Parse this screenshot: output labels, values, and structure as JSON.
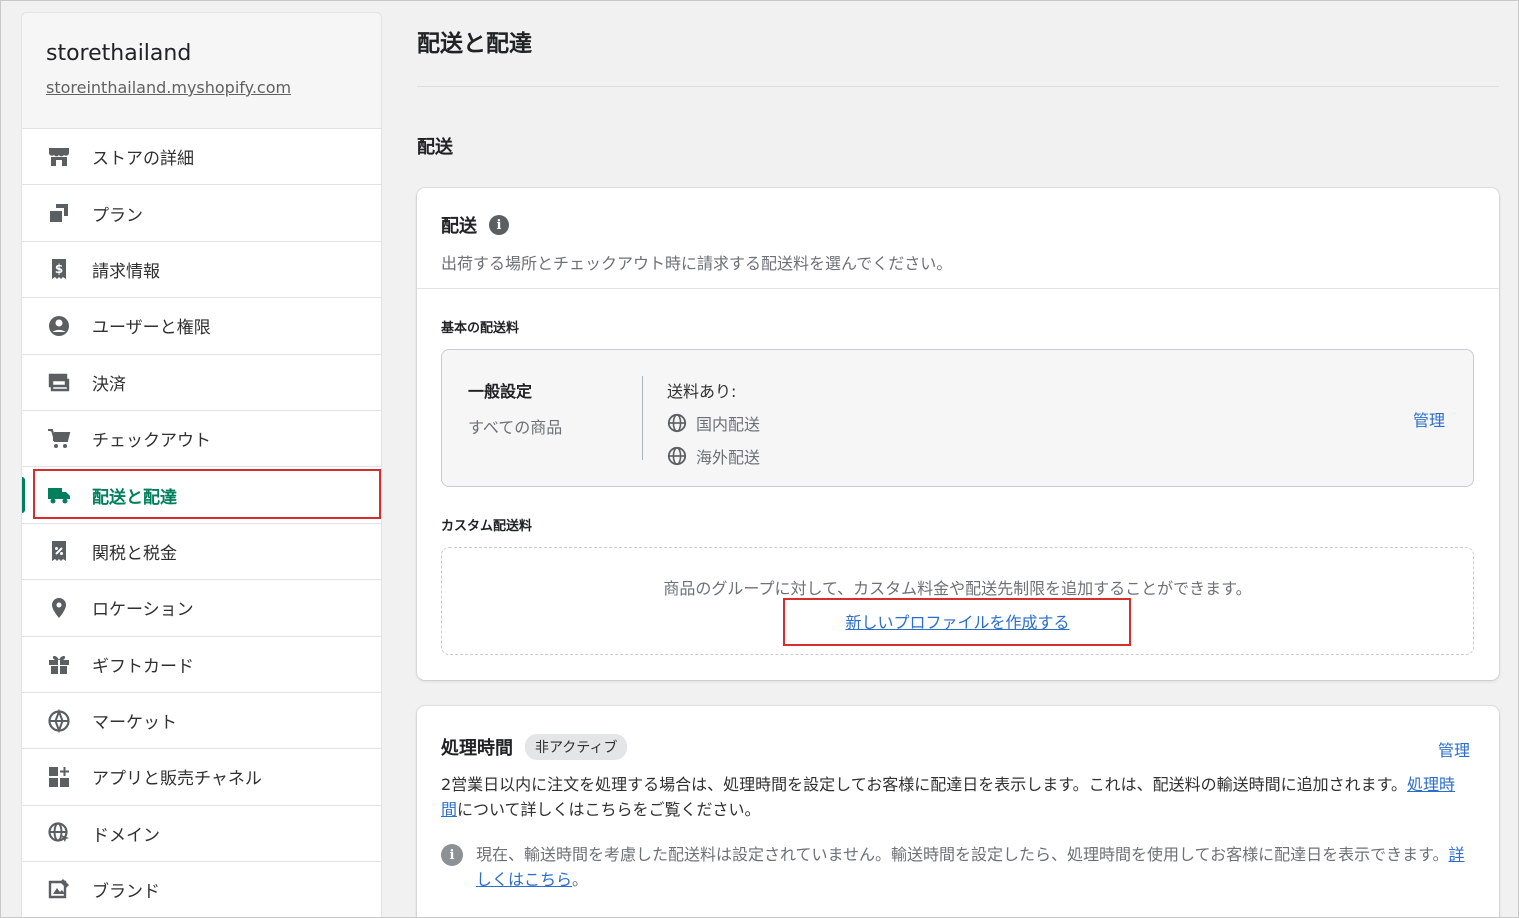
{
  "store": {
    "name": "storethailand",
    "url": "storeinthailand.myshopify.com"
  },
  "sidebar": {
    "items": [
      {
        "label": "ストアの詳細",
        "icon": "store-icon"
      },
      {
        "label": "プラン",
        "icon": "plan-icon"
      },
      {
        "label": "請求情報",
        "icon": "billing-icon"
      },
      {
        "label": "ユーザーと権限",
        "icon": "user-icon"
      },
      {
        "label": "決済",
        "icon": "payment-icon"
      },
      {
        "label": "チェックアウト",
        "icon": "cart-icon"
      },
      {
        "label": "配送と配達",
        "icon": "truck-icon",
        "active": true
      },
      {
        "label": "関税と税金",
        "icon": "tax-icon"
      },
      {
        "label": "ロケーション",
        "icon": "location-icon"
      },
      {
        "label": "ギフトカード",
        "icon": "gift-icon"
      },
      {
        "label": "マーケット",
        "icon": "globe-icon"
      },
      {
        "label": "アプリと販売チャネル",
        "icon": "apps-icon"
      },
      {
        "label": "ドメイン",
        "icon": "domain-icon"
      },
      {
        "label": "ブランド",
        "icon": "brand-icon"
      }
    ],
    "accent_color": "#007f5f"
  },
  "main": {
    "page_title": "配送と配達",
    "section_title": "配送",
    "shipping_card": {
      "title": "配送",
      "description": "出荷する場所とチェックアウト時に請求する配送料を選んでください。",
      "general_rates_label": "基本の配送料",
      "profile": {
        "name": "一般設定",
        "subtitle": "すべての商品",
        "rates_label": "送料あり:",
        "zones": [
          "国内配送",
          "海外配送"
        ],
        "manage_label": "管理"
      },
      "custom_rates_label": "カスタム配送料",
      "custom_desc": "商品のグループに対して、カスタム料金や配送先制限を追加することができます。",
      "create_profile_link": "新しいプロファイルを作成する"
    },
    "processing_card": {
      "title": "処理時間",
      "badge": "非アクティブ",
      "manage_label": "管理",
      "body_before": "2営業日以内に注文を処理する場合は、処理時間を設定してお客様に配達日を表示します。これは、配送料の輸送時間に追加されます。",
      "body_link": "処理時間",
      "body_after": "について詳しくはこちらをご覧ください。",
      "note_text": "現在、輸送時間を考慮した配送料は設定されていません。輸送時間を設定したら、処理時間を使用してお客様に配達日を表示できます。",
      "note_link": "詳しくはこちら",
      "note_end": "。"
    }
  },
  "colors": {
    "link": "#2c6ecb",
    "highlight_box": "#d92c2c"
  }
}
